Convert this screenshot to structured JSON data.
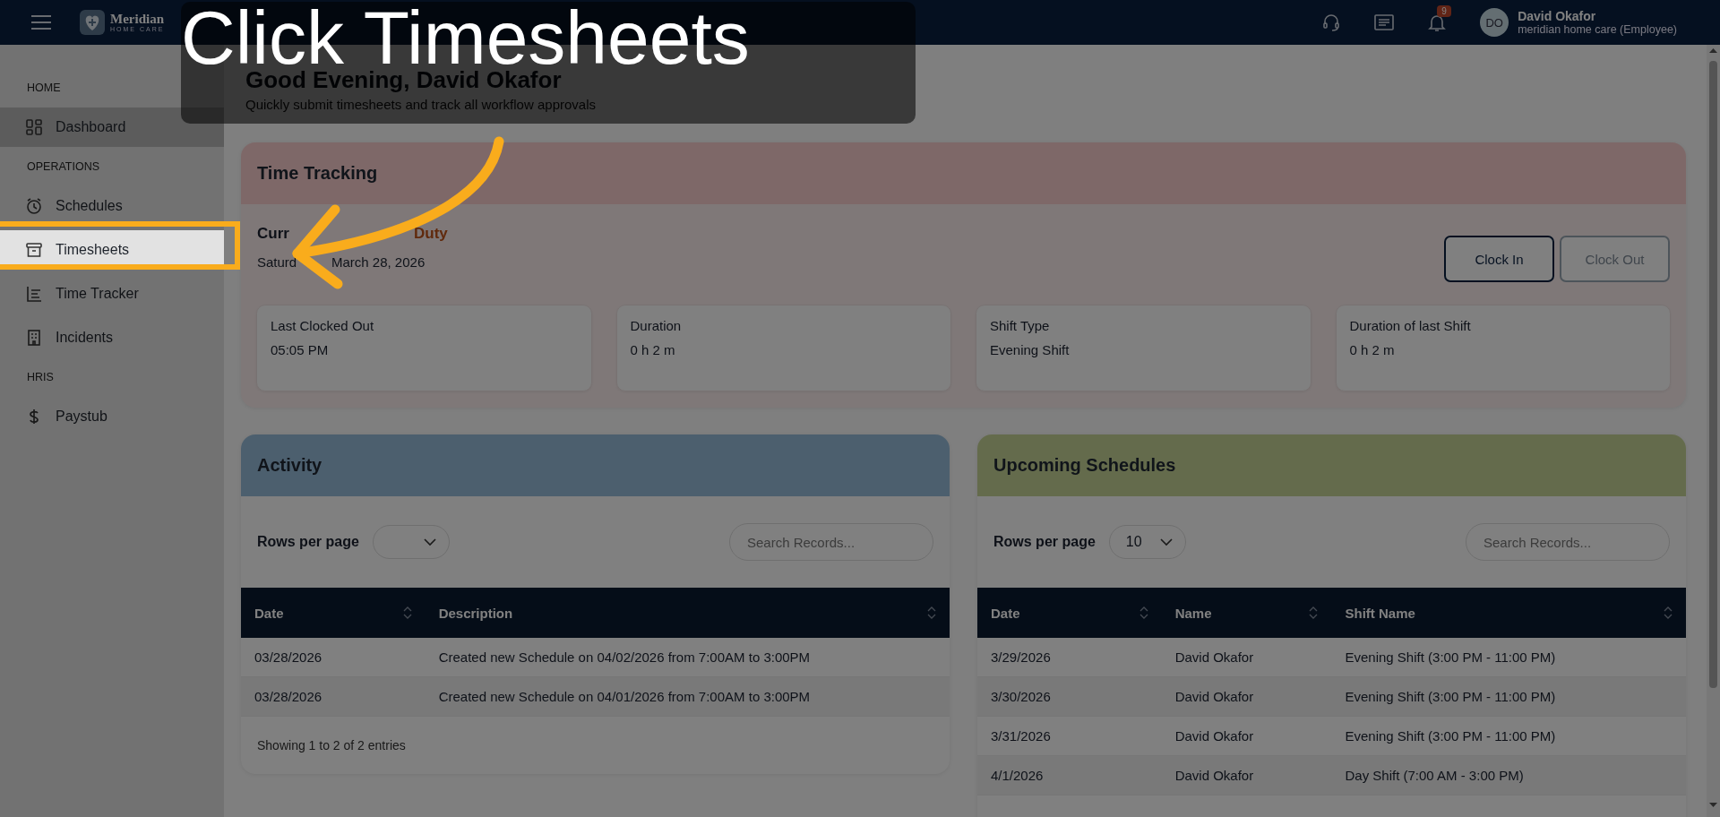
{
  "topbar": {
    "brand": "Meridian",
    "brand_sub": "HOME CARE",
    "notification_count": "9",
    "user_initials": "DO",
    "user_name": "David Okafor",
    "user_role": "meridian home care (Employee)"
  },
  "sidebar": {
    "sections": [
      {
        "heading": "HOME",
        "items": [
          {
            "label": "Dashboard",
            "kind": "grid",
            "selected": true,
            "highlighted": false
          }
        ]
      },
      {
        "heading": "OPERATIONS",
        "items": [
          {
            "label": "Schedules",
            "kind": "alarm",
            "selected": false,
            "highlighted": false
          },
          {
            "label": "Timesheets",
            "kind": "archive",
            "selected": false,
            "highlighted": true
          },
          {
            "label": "Time Tracker",
            "kind": "list",
            "selected": false,
            "highlighted": false
          },
          {
            "label": "Incidents",
            "kind": "building",
            "selected": false,
            "highlighted": false
          }
        ]
      },
      {
        "heading": "HRIS",
        "items": [
          {
            "label": "Paystub",
            "kind": "dollar",
            "selected": false,
            "highlighted": false
          }
        ]
      }
    ]
  },
  "greeting": {
    "title": "Good Evening, David Okafor",
    "subtitle": "Quickly submit timesheets and track all workflow approvals"
  },
  "time_tracking": {
    "title": "Time Tracking",
    "status_parts": [
      {
        "text": "Curr",
        "kind": "label"
      },
      {
        "text": "Duty",
        "kind": "value"
      }
    ],
    "date_parts": [
      "Saturd",
      "March 28, 2026"
    ],
    "buttons": [
      {
        "label": "Clock In",
        "disabled": false
      },
      {
        "label": "Clock Out",
        "disabled": true
      }
    ],
    "stats": [
      {
        "label": "Last Clocked Out",
        "value": "05:05 PM"
      },
      {
        "label": "Duration",
        "value": "0 h 2 m"
      },
      {
        "label": "Shift Type",
        "value": "Evening Shift"
      },
      {
        "label": "Duration of last Shift",
        "value": "0 h 2 m"
      }
    ]
  },
  "activity": {
    "title": "Activity",
    "rows_label": "Rows per page",
    "search_placeholder": "Search Records...",
    "columns": [
      "Date",
      "Description"
    ],
    "rows": [
      [
        "03/28/2026",
        "Created new Schedule on 04/02/2026 from 7:00AM to 3:00PM"
      ],
      [
        "03/28/2026",
        "Created new Schedule on 04/01/2026 from 7:00AM to 3:00PM"
      ]
    ],
    "footer": "Showing 1 to 2 of 2 entries"
  },
  "upcoming": {
    "title": "Upcoming Schedules",
    "rows_label": "Rows per page",
    "rows_value": "10",
    "search_placeholder": "Search Records...",
    "columns": [
      "Date",
      "Name",
      "Shift Name"
    ],
    "rows": [
      [
        "3/29/2026",
        "David Okafor",
        "Evening Shift (3:00 PM - 11:00 PM)"
      ],
      [
        "3/30/2026",
        "David Okafor",
        "Evening Shift (3:00 PM - 11:00 PM)"
      ],
      [
        "3/31/2026",
        "David Okafor",
        "Evening Shift (3:00 PM - 11:00 PM)"
      ],
      [
        "4/1/2026",
        "David Okafor",
        "Day Shift (7:00 AM - 3:00 PM)"
      ]
    ]
  },
  "tour": {
    "caption": "Click Timesheets"
  }
}
